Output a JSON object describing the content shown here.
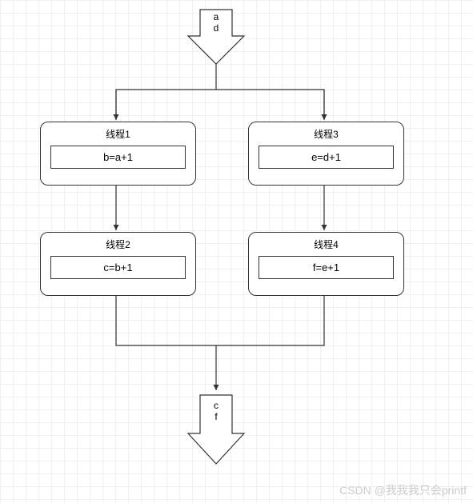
{
  "input": {
    "line1": "a",
    "line2": "d"
  },
  "output": {
    "line1": "c",
    "line2": "f"
  },
  "threads": {
    "t1": {
      "title": "线程1",
      "expr": "b=a+1"
    },
    "t2": {
      "title": "线程2",
      "expr": "c=b+1"
    },
    "t3": {
      "title": "线程3",
      "expr": "e=d+1"
    },
    "t4": {
      "title": "线程4",
      "expr": "f=e+1"
    }
  },
  "watermark": "CSDN @我我我只会printf",
  "chart_data": {
    "type": "diagram",
    "nodes": [
      {
        "id": "in",
        "type": "input-arrow",
        "label": "a d"
      },
      {
        "id": "t1",
        "type": "process",
        "title": "线程1",
        "expr": "b=a+1"
      },
      {
        "id": "t2",
        "type": "process",
        "title": "线程2",
        "expr": "c=b+1"
      },
      {
        "id": "t3",
        "type": "process",
        "title": "线程3",
        "expr": "e=d+1"
      },
      {
        "id": "t4",
        "type": "process",
        "title": "线程4",
        "expr": "f=e+1"
      },
      {
        "id": "out",
        "type": "output-arrow",
        "label": "c f"
      }
    ],
    "edges": [
      {
        "from": "in",
        "to": "t1"
      },
      {
        "from": "in",
        "to": "t3"
      },
      {
        "from": "t1",
        "to": "t2"
      },
      {
        "from": "t3",
        "to": "t4"
      },
      {
        "from": "t2",
        "to": "out"
      },
      {
        "from": "t4",
        "to": "out"
      }
    ]
  }
}
